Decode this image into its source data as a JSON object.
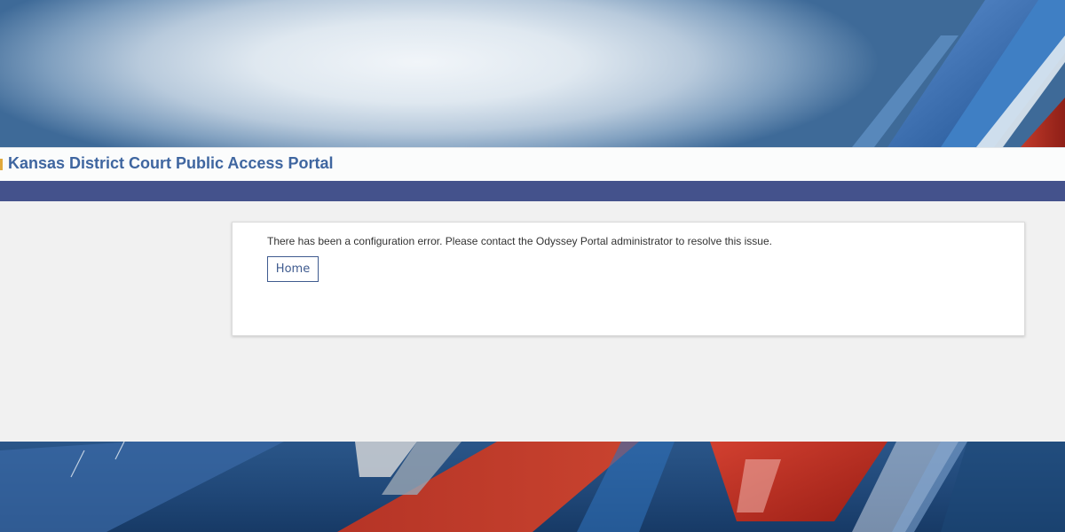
{
  "header": {
    "title": "Kansas District Court Public Access Portal"
  },
  "message": {
    "text": "There has been a configuration error. Please contact the Odyssey Portal administrator to resolve this issue.",
    "home_label": "Home"
  },
  "colors": {
    "title": "#3f66a0",
    "nav_bar": "#44528c",
    "content_bg": "#f1f1f1",
    "button_border": "#3f5b8f"
  }
}
